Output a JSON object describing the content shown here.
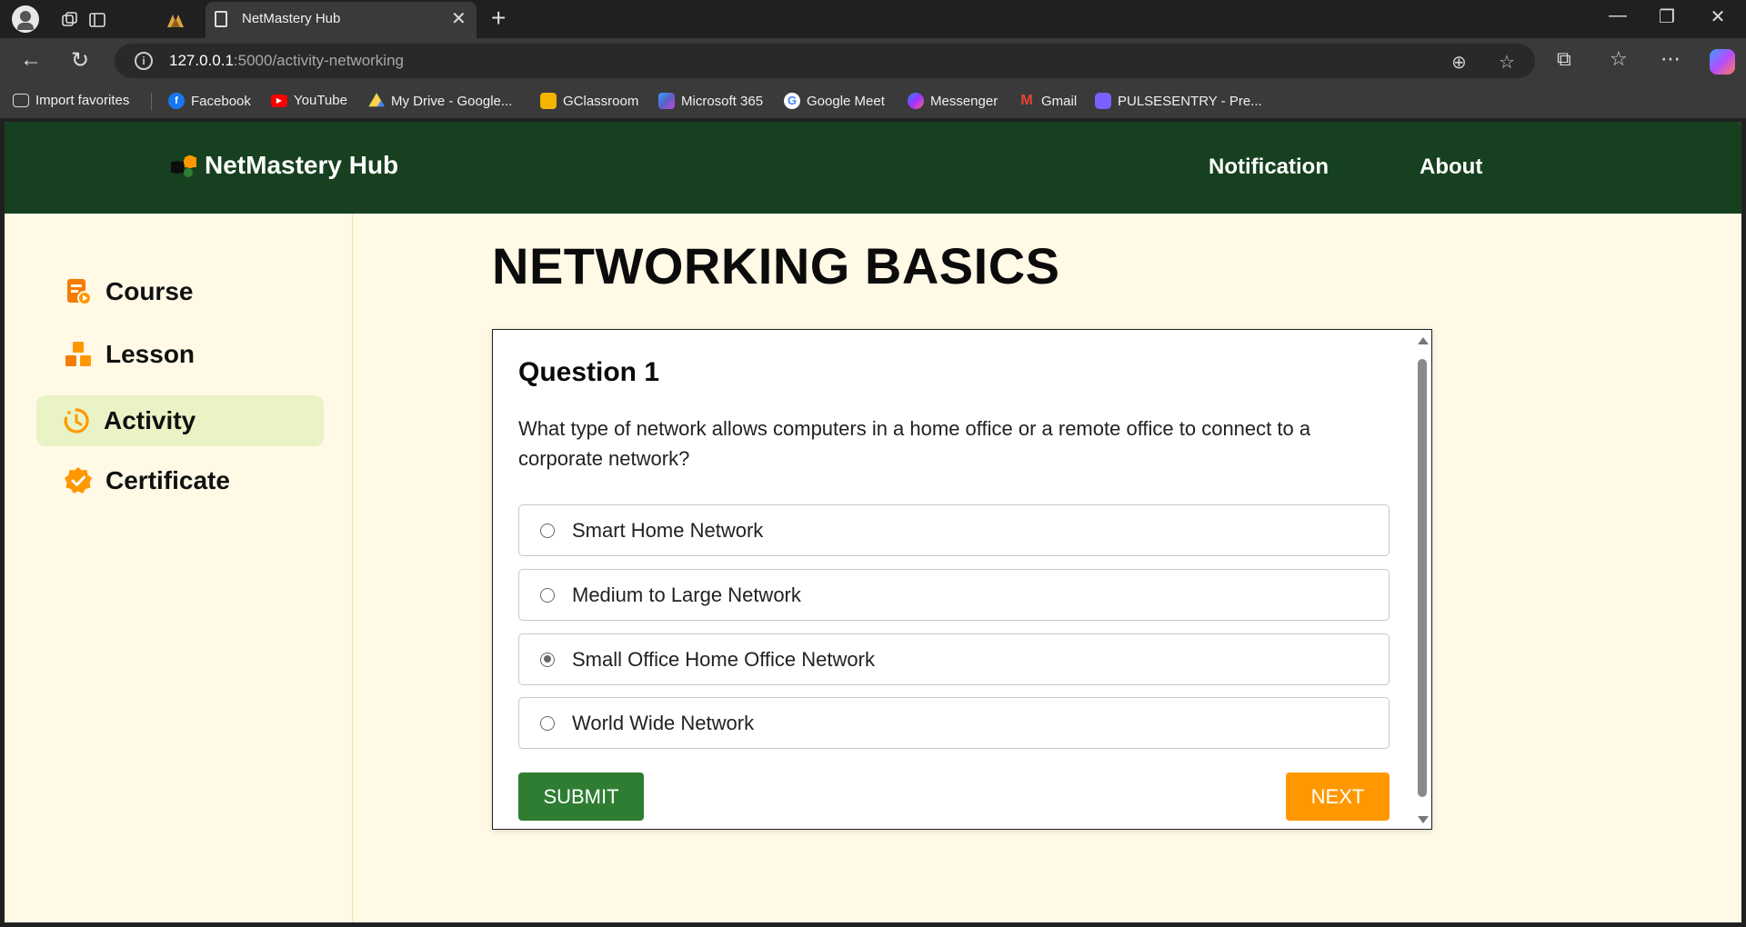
{
  "browser": {
    "tab_title": "NetMastery Hub",
    "url_host": "127.0.0.1",
    "url_path": ":5000/activity-networking",
    "bookmarks": [
      {
        "label": "Import favorites",
        "color": "#3a3a3a"
      },
      {
        "label": "Facebook",
        "color": "#1877f2"
      },
      {
        "label": "YouTube",
        "color": "#ff0000"
      },
      {
        "label": "My Drive - Google...",
        "color": "#1fa463"
      },
      {
        "label": "GClassroom",
        "color": "#f4b400"
      },
      {
        "label": "Microsoft 365",
        "color": "#5b5fc7"
      },
      {
        "label": "Google Meet",
        "color": "#ffffff"
      },
      {
        "label": "Messenger",
        "color": "#a033ff"
      },
      {
        "label": "Gmail",
        "color": "#ea4335"
      },
      {
        "label": "PULSESENTRY - Pre...",
        "color": "#7b61ff"
      }
    ]
  },
  "header": {
    "logo_text": "NetMastery Hub",
    "nav": [
      "Notification",
      "About"
    ]
  },
  "sidebar": {
    "items": [
      {
        "label": "Course",
        "icon": "course-icon",
        "active": false
      },
      {
        "label": "Lesson",
        "icon": "lesson-icon",
        "active": false
      },
      {
        "label": "Activity",
        "icon": "activity-icon",
        "active": true
      },
      {
        "label": "Certificate",
        "icon": "certificate-icon",
        "active": false
      }
    ]
  },
  "main": {
    "title": "NETWORKING BASICS",
    "question": {
      "title": "Question 1",
      "text": "What type of network allows computers in a home office or a remote office to connect to a corporate network?",
      "options": [
        {
          "label": "Smart Home Network",
          "checked": false
        },
        {
          "label": "Medium to Large Network",
          "checked": false
        },
        {
          "label": "Small Office Home Office Network",
          "checked": true
        },
        {
          "label": "World Wide Network",
          "checked": false
        }
      ]
    },
    "submit_label": "SUBMIT",
    "next_label": "NEXT"
  },
  "colors": {
    "header_bg": "#16401f",
    "page_bg": "#fff9e6",
    "accent_orange": "#ff9800",
    "submit_green": "#2e7d32",
    "active_item_bg": "#e9f3c6"
  }
}
